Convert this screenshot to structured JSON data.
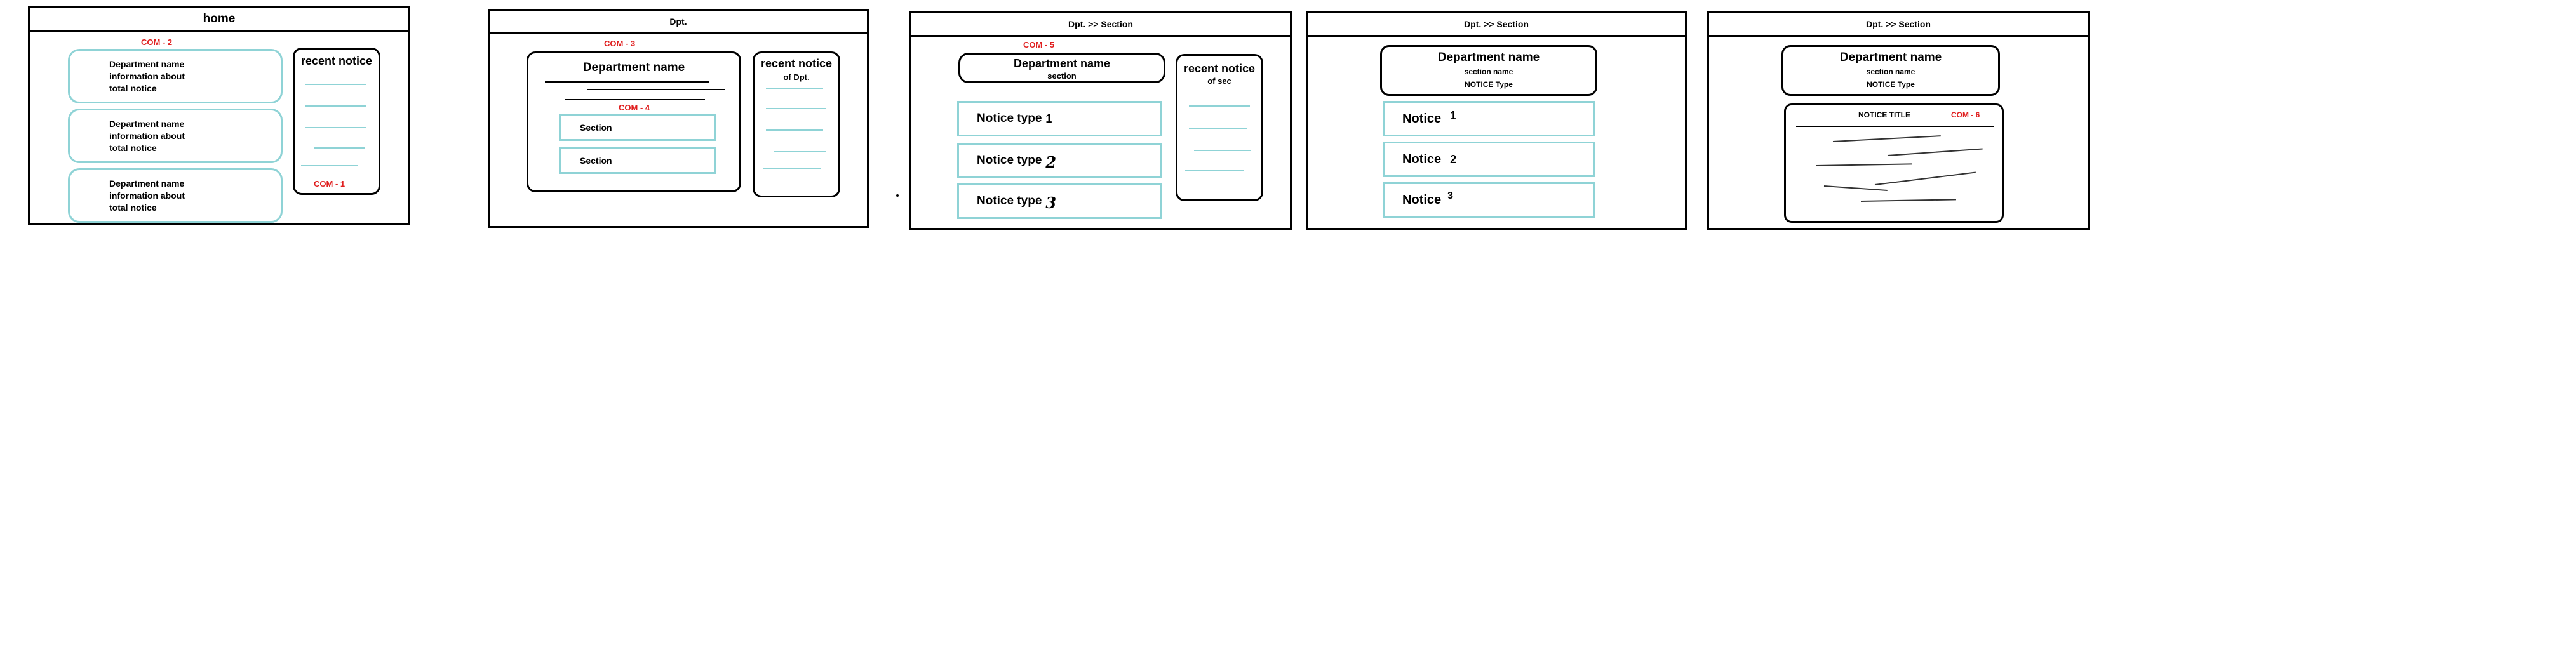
{
  "home": {
    "title": "home",
    "com_list": "COM - 2",
    "dept_cards": [
      {
        "line1": "Department name",
        "line2": "information about",
        "line3": "total notice"
      },
      {
        "line1": "Department name",
        "line2": "information about",
        "line3": "total notice"
      },
      {
        "line1": "Department name",
        "line2": "information about",
        "line3": "total notice"
      }
    ],
    "recent_title": "recent notice",
    "com_recent": "COM - 1"
  },
  "dept": {
    "title": "Dpt.",
    "com_dept": "COM - 3",
    "dept_name": "Department name",
    "com_sections": "COM - 4",
    "sections": [
      "Section",
      "Section"
    ],
    "recent_title": "recent notice",
    "recent_sub": "of Dpt."
  },
  "section": {
    "title": "Dpt.  >> Section",
    "com_header": "COM - 5",
    "dept_name": "Department name",
    "section_label": "section",
    "notice_types": [
      {
        "label": "Notice type",
        "num": "1"
      },
      {
        "label": "Notice type",
        "num": "2"
      },
      {
        "label": "Notice type",
        "num": "3"
      }
    ],
    "recent_title": "recent notice",
    "recent_sub": "of  sec"
  },
  "type_view": {
    "title": "Dpt.  >> Section",
    "dept_name": "Department name",
    "section_name": "section name",
    "notice_type": "NOTICE Type",
    "notices": [
      {
        "label": "Notice",
        "num": "1"
      },
      {
        "label": "Notice",
        "num": "2"
      },
      {
        "label": "Notice",
        "num": "3"
      }
    ]
  },
  "detail": {
    "title": "Dpt.  >> Section",
    "dept_name": "Department name",
    "section_name": "section name",
    "notice_type": "NOTICE Type",
    "notice_title": "NOTICE TITLE",
    "com_detail": "COM - 6"
  }
}
